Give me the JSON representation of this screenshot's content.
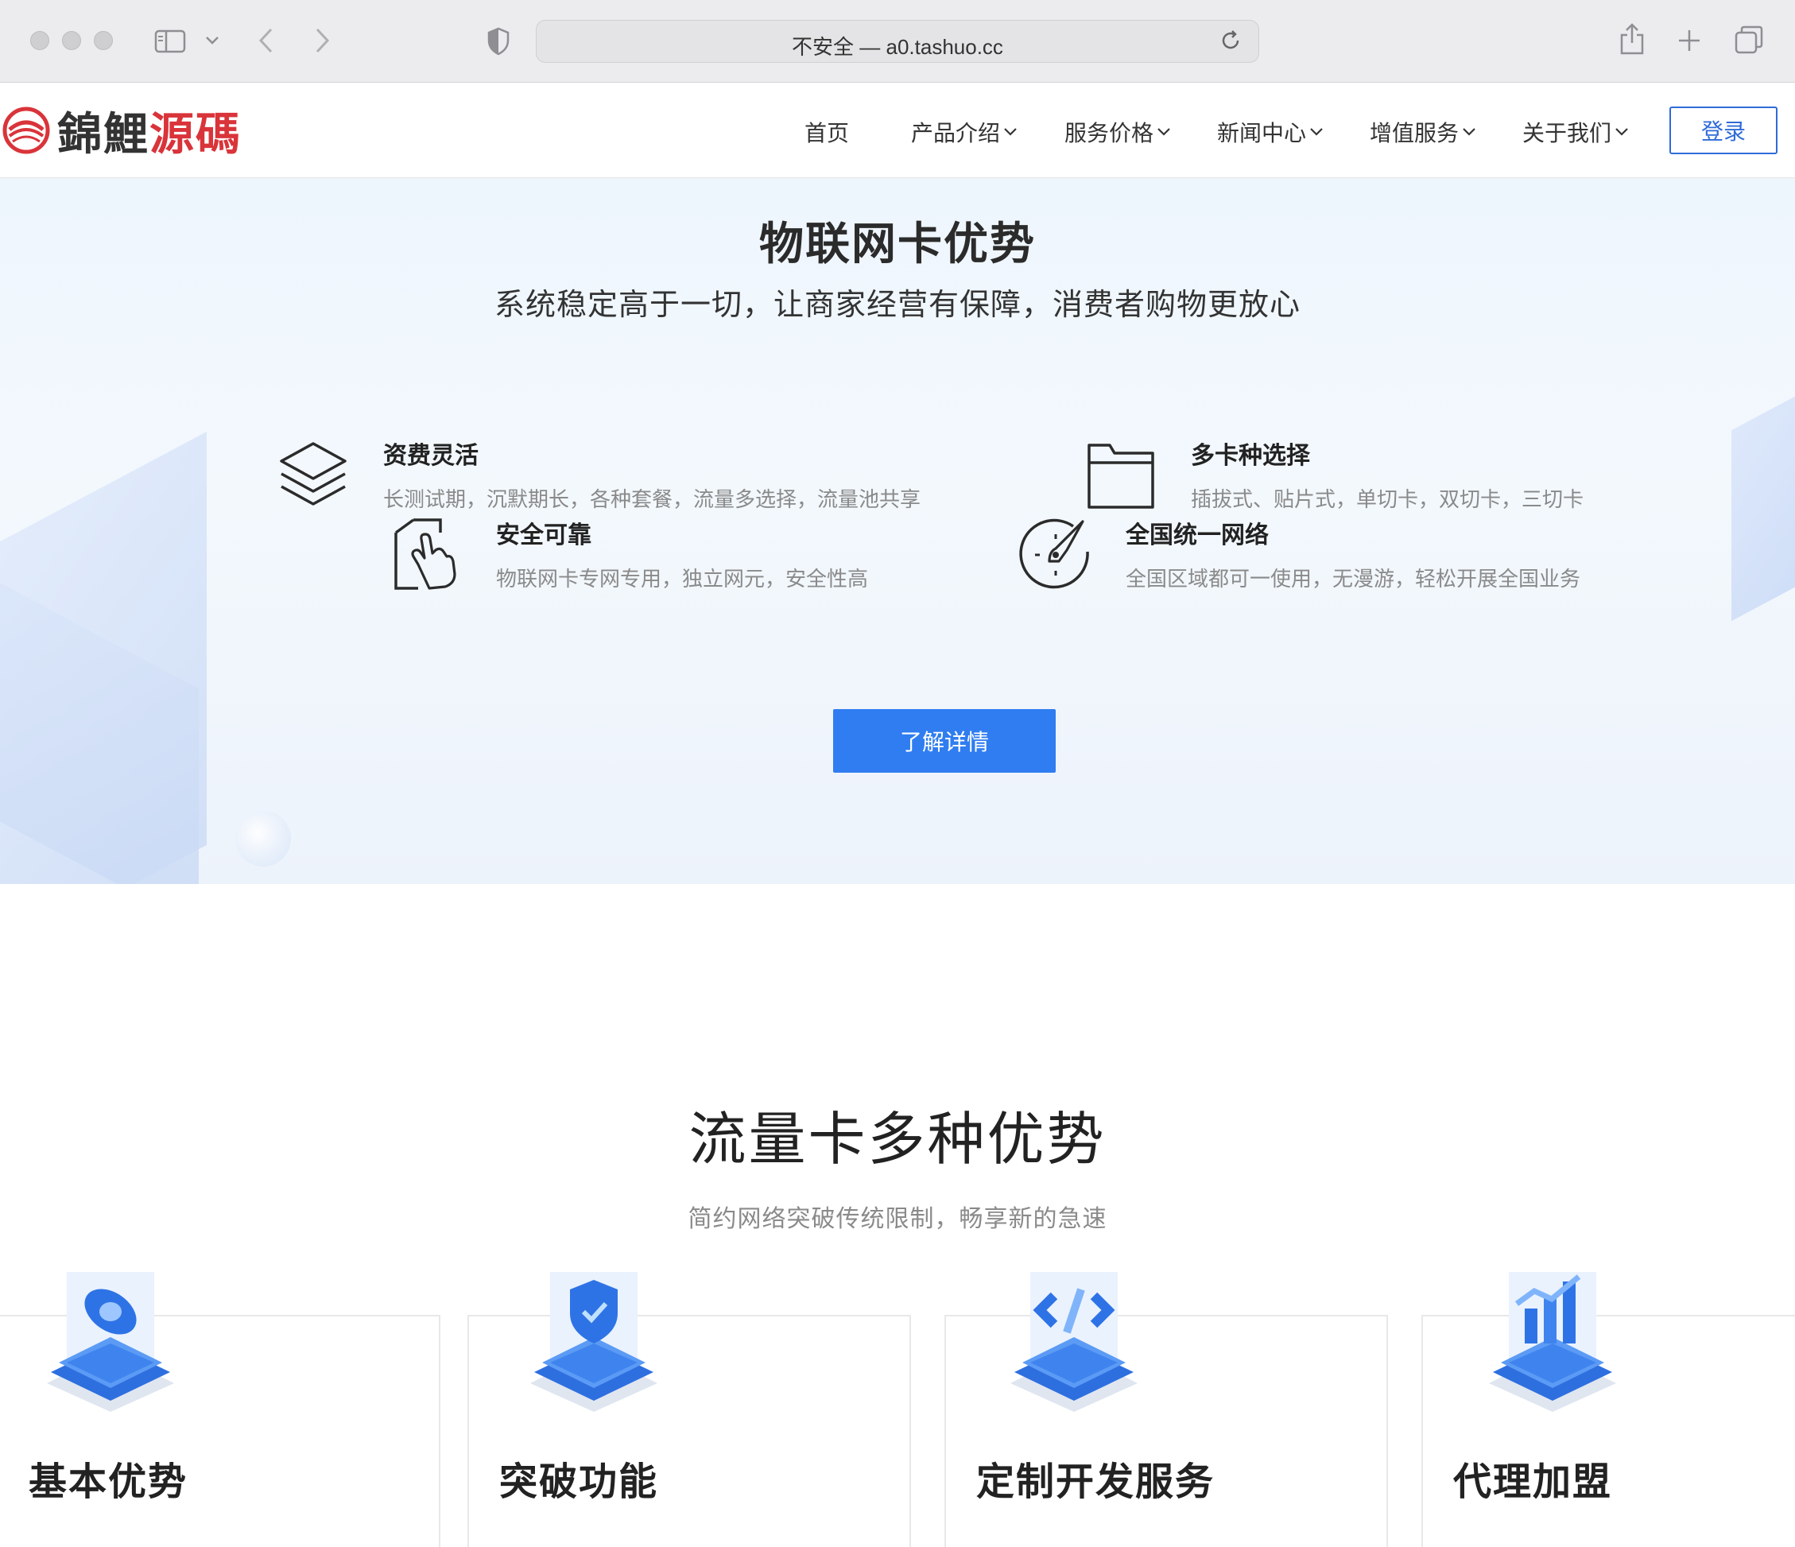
{
  "browser": {
    "address": "不安全 — a0.tashuo.cc",
    "icons": [
      "sidebar-icon",
      "chevron-down-icon",
      "back-icon",
      "forward-icon",
      "shield-icon",
      "reload-icon",
      "share-icon",
      "plus-icon",
      "tabs-icon"
    ]
  },
  "nav": {
    "logo_part1": "錦鯉",
    "logo_part2": "源碼",
    "items": [
      {
        "label": "首页"
      },
      {
        "label": "产品介绍"
      },
      {
        "label": "服务价格"
      },
      {
        "label": "新闻中心"
      },
      {
        "label": "增值服务"
      },
      {
        "label": "关于我们"
      }
    ],
    "login": "登录"
  },
  "hero": {
    "title": "物联网卡优势",
    "subtitle": "系统稳定高于一切，让商家经营有保障，消费者购物更放心",
    "features": [
      {
        "title": "资费灵活",
        "desc": "长测试期，沉默期长，各种套餐，流量多选择，流量池共享",
        "icon": "layers-icon"
      },
      {
        "title": "多卡种选择",
        "desc": "插拔式、贴片式，单切卡，双切卡，三切卡",
        "icon": "folder-icon"
      },
      {
        "title": "安全可靠",
        "desc": "物联网卡专网专用，独立网元，安全性高",
        "icon": "touch-icon"
      },
      {
        "title": "全国统一网络",
        "desc": "全国区域都可一使用，无漫游，轻松开展全国业务",
        "icon": "compass-icon"
      }
    ],
    "cta": "了解详情"
  },
  "section2": {
    "title": "流量卡多种优势",
    "subtitle": "简约网络突破传统限制，畅享新的急速",
    "cards": [
      {
        "title": "基本优势",
        "icon": "eye-cube-icon"
      },
      {
        "title": "突破功能",
        "icon": "shield-cube-icon"
      },
      {
        "title": "定制开发服务",
        "icon": "code-cube-icon"
      },
      {
        "title": "代理加盟",
        "icon": "chart-cube-icon"
      }
    ]
  },
  "colors": {
    "brand_red": "#d9343a",
    "accent_blue": "#2f7df0",
    "login_blue": "#2f6bd8"
  }
}
